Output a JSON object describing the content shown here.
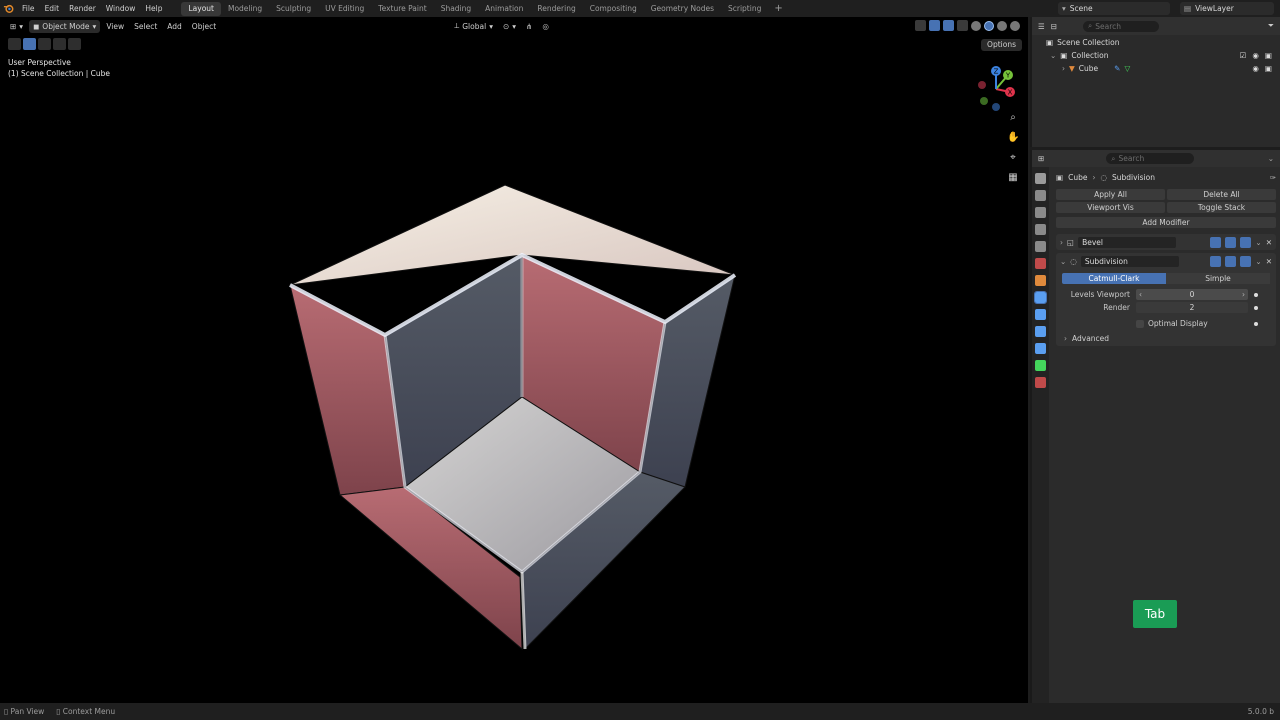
{
  "menu": [
    "File",
    "Edit",
    "Render",
    "Window",
    "Help"
  ],
  "workspaces": [
    {
      "label": "Layout",
      "active": true
    },
    {
      "label": "Modeling",
      "active": false
    },
    {
      "label": "Sculpting",
      "active": false
    },
    {
      "label": "UV Editing",
      "active": false
    },
    {
      "label": "Texture Paint",
      "active": false
    },
    {
      "label": "Shading",
      "active": false
    },
    {
      "label": "Animation",
      "active": false
    },
    {
      "label": "Rendering",
      "active": false
    },
    {
      "label": "Compositing",
      "active": false
    },
    {
      "label": "Geometry Nodes",
      "active": false
    },
    {
      "label": "Scripting",
      "active": false
    }
  ],
  "workspace_add": "+",
  "scene": "Scene",
  "view_layer": "ViewLayer",
  "viewport": {
    "mode": "Object Mode",
    "menus": [
      "View",
      "Select",
      "Add",
      "Object"
    ],
    "transform_orientation": "Global",
    "options": "Options",
    "perspective": "User Perspective",
    "collection_path": "(1) Scene Collection | Cube",
    "gizmo_labels": {
      "x": "X",
      "y": "Y",
      "z": "Z"
    }
  },
  "outliner": {
    "search_placeholder": "Search",
    "rows": [
      {
        "label": "Scene Collection",
        "indent": 0
      },
      {
        "label": "Collection",
        "indent": 1
      },
      {
        "label": "Cube",
        "indent": 2
      }
    ]
  },
  "properties": {
    "search_placeholder": "Search",
    "breadcrumb": {
      "object": "Cube",
      "modifier": "Subdivision"
    },
    "apply_all": "Apply All",
    "delete_all": "Delete All",
    "viewport_vis": "Viewport Vis",
    "toggle_stack": "Toggle Stack",
    "add_modifier": "Add Modifier",
    "modifiers": [
      {
        "name": "Bevel",
        "expanded": false
      },
      {
        "name": "Subdivision",
        "expanded": true
      }
    ],
    "subdiv": {
      "type_options": [
        "Catmull-Clark",
        "Simple"
      ],
      "selected_type": "Catmull-Clark",
      "levels_viewport_label": "Levels Viewport",
      "levels_viewport": "0",
      "render_label": "Render",
      "render": "2",
      "optimal_display": "Optimal Display",
      "advanced": "Advanced"
    }
  },
  "key_overlay": "Tab",
  "status": {
    "pan_view": "Pan View",
    "context_menu": "Context Menu",
    "version": "5.0.0 b"
  },
  "colors": {
    "accent": "#4772b3",
    "key_badge": "#1a9c55",
    "axis_x": "#e0334b",
    "axis_y": "#76c13a",
    "axis_z": "#3c83e0"
  }
}
